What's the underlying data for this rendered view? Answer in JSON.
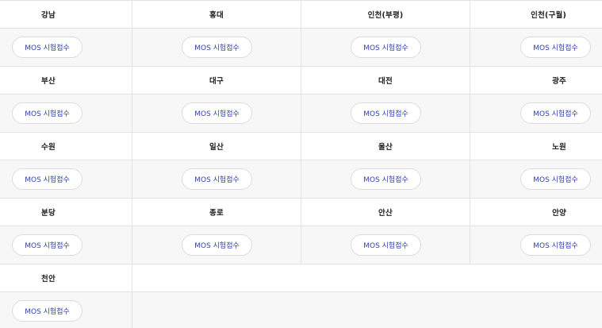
{
  "centers": [
    {
      "name": "강남",
      "button": "MOS 시험접수"
    },
    {
      "name": "홍대",
      "button": "MOS 시험접수"
    },
    {
      "name": "인천(부평)",
      "button": "MOS 시험접수"
    },
    {
      "name": "인천(구월)",
      "button": "MOS 시험접수"
    },
    {
      "name": "부산",
      "button": "MOS 시험접수"
    },
    {
      "name": "대구",
      "button": "MOS 시험접수"
    },
    {
      "name": "대전",
      "button": "MOS 시험접수"
    },
    {
      "name": "광주",
      "button": "MOS 시험접수"
    },
    {
      "name": "수원",
      "button": "MOS 시험접수"
    },
    {
      "name": "일산",
      "button": "MOS 시험접수"
    },
    {
      "name": "울산",
      "button": "MOS 시험접수"
    },
    {
      "name": "노원",
      "button": "MOS 시험접수"
    },
    {
      "name": "분당",
      "button": "MOS 시험접수"
    },
    {
      "name": "종로",
      "button": "MOS 시험접수"
    },
    {
      "name": "안산",
      "button": "MOS 시험접수"
    },
    {
      "name": "안양",
      "button": "MOS 시험접수"
    },
    {
      "name": "천안",
      "button": "MOS 시험접수"
    }
  ],
  "colors": {
    "button_text": "#2f3fb0",
    "border": "#e3e3e3",
    "alt_row_bg": "#f7f7f7"
  }
}
